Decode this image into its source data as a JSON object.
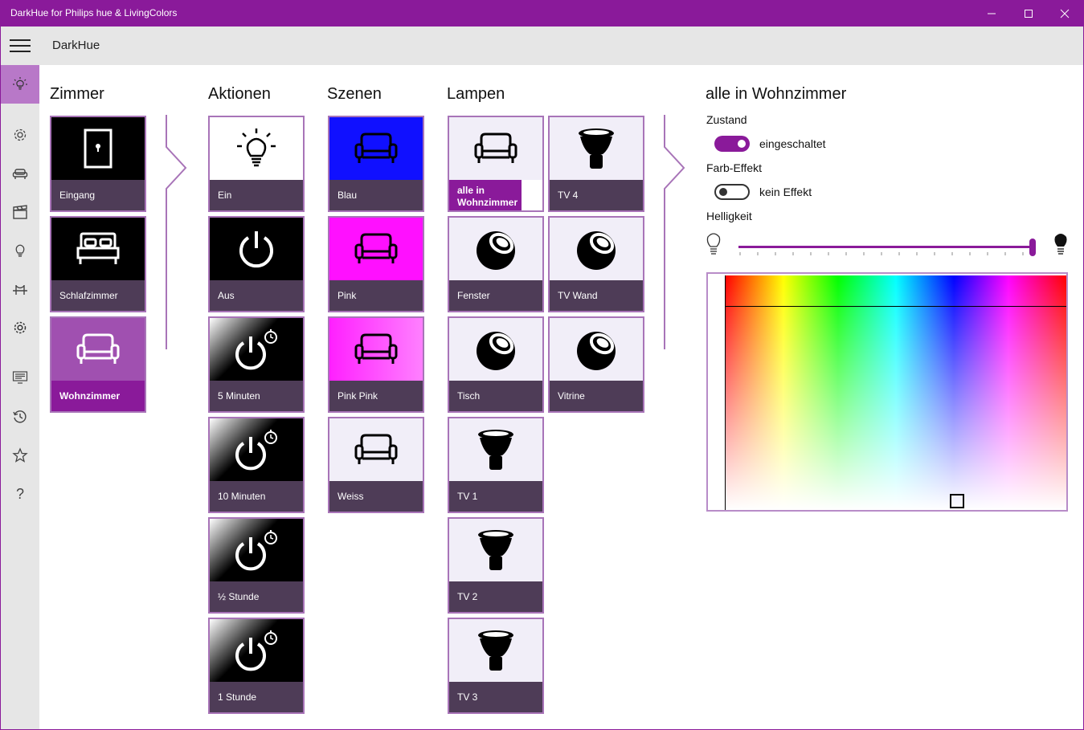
{
  "window": {
    "title": "DarkHue for Philips hue & LivingColors",
    "minimize_icon": "minimize-icon",
    "maximize_icon": "maximize-icon",
    "close_icon": "close-icon"
  },
  "appbar": {
    "title": "DarkHue",
    "menu_icon": "hamburger-icon"
  },
  "sidebar": {
    "items": [
      {
        "icon": "bulb-sun-icon",
        "active": true
      },
      {
        "icon": "gear-icon"
      },
      {
        "icon": "sofa-icon"
      },
      {
        "icon": "clapperboard-icon"
      },
      {
        "icon": "bulb-icon"
      },
      {
        "icon": "bridge-icon"
      },
      {
        "icon": "settings-icon"
      },
      {
        "icon": "log-icon"
      },
      {
        "icon": "history-icon"
      },
      {
        "icon": "star-icon"
      },
      {
        "icon": "help-icon"
      }
    ]
  },
  "columns": {
    "rooms": "Zimmer",
    "actions": "Aktionen",
    "scenes": "Szenen",
    "lamps": "Lampen"
  },
  "rooms": [
    {
      "label": "Eingang",
      "icon": "door-icon"
    },
    {
      "label": "Schlafzimmer",
      "icon": "bed-icon"
    },
    {
      "label": "Wohnzimmer",
      "icon": "sofa-icon",
      "selected": true
    }
  ],
  "actions": [
    {
      "label": "Ein",
      "icon": "bulb-on-icon"
    },
    {
      "label": "Aus",
      "icon": "power-icon"
    },
    {
      "label": "5 Minuten",
      "icon": "power-timer-icon"
    },
    {
      "label": "10 Minuten",
      "icon": "power-timer-icon"
    },
    {
      "label": "½ Stunde",
      "icon": "power-timer-icon"
    },
    {
      "label": "1 Stunde",
      "icon": "power-timer-icon"
    }
  ],
  "scenes": [
    {
      "label": "Blau",
      "icon": "sofa-icon",
      "color": "#1010ff"
    },
    {
      "label": "Pink",
      "icon": "sofa-icon",
      "color": "#ff10ff"
    },
    {
      "label": "Pink Pink",
      "icon": "sofa-icon",
      "color": "#ff40ff"
    },
    {
      "label": "Weiss",
      "icon": "sofa-icon",
      "color": "#f1eef8"
    }
  ],
  "lamps": [
    {
      "label": "alle in Wohnzimmer",
      "icon": "sofa-icon",
      "selected": true
    },
    {
      "label": "TV 4",
      "icon": "spot-lamp-icon"
    },
    {
      "label": "Fenster",
      "icon": "living-colors-icon"
    },
    {
      "label": "TV Wand",
      "icon": "living-colors-icon"
    },
    {
      "label": "Tisch",
      "icon": "living-colors-icon"
    },
    {
      "label": "Vitrine",
      "icon": "living-colors-icon"
    },
    {
      "label": "TV 1",
      "icon": "spot-lamp-icon"
    },
    {
      "label": "TV 2",
      "icon": "spot-lamp-icon"
    },
    {
      "label": "TV 3",
      "icon": "spot-lamp-icon"
    }
  ],
  "detail": {
    "title": "alle in Wohnzimmer",
    "state_label": "Zustand",
    "state_value": "eingeschaltet",
    "state_on": true,
    "effect_label": "Farb-Effekt",
    "effect_value": "kein Effekt",
    "effect_on": false,
    "brightness_label": "Helligkeit",
    "brightness_fraction": 1.0,
    "accent_color": "#8a1a9a"
  }
}
